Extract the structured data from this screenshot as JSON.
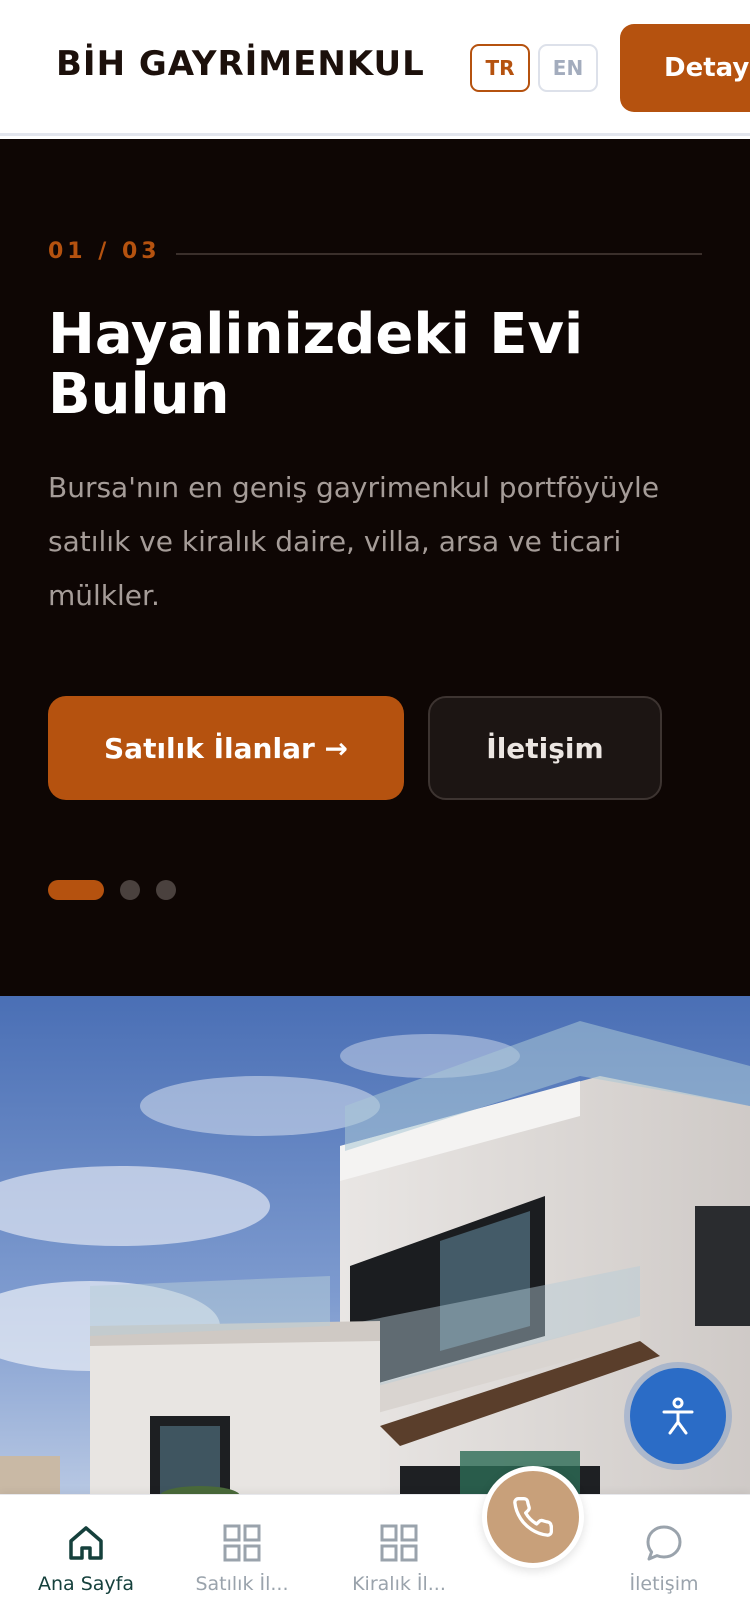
{
  "header": {
    "brand": "BİH GAYRİMENKUL",
    "lang_tr": "TR",
    "lang_en": "EN",
    "details_label": "Detay"
  },
  "hero": {
    "counter": "01 / 03",
    "title": "Hayalinizdeki Evi Bulun",
    "subtitle": "Bursa'nın en geniş gayrimenkul portföyüyle satılık ve kiralık daire, villa, arsa ve ticari mülkler.",
    "primary_cta": "Satılık İlanlar →",
    "secondary_cta": "İletişim",
    "slides_total": 3,
    "active_slide": 1
  },
  "colors": {
    "accent": "#b5520f",
    "hero_bg": "#0e0604",
    "call_button": "#c8a07a",
    "accessibility_button": "#2b6cc6",
    "nav_active": "#15403c"
  },
  "photo": {
    "subject": "modern white villa with glass balconies under blue sky"
  },
  "bottom_nav": {
    "items": [
      {
        "label": "Ana Sayfa",
        "icon": "home-icon",
        "active": true
      },
      {
        "label": "Satılık İl...",
        "icon": "grid-icon",
        "active": false
      },
      {
        "label": "Kiralık İl...",
        "icon": "grid-icon",
        "active": false
      },
      {
        "label": "İletişim",
        "icon": "chat-icon",
        "active": false
      }
    ],
    "call_icon": "phone-icon",
    "accessibility_icon": "accessibility-icon"
  }
}
